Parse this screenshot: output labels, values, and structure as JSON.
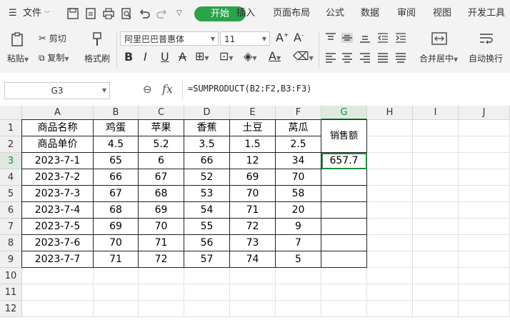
{
  "menubar": {
    "file_label": "文件",
    "tabs": [
      "开始",
      "插入",
      "页面布局",
      "公式",
      "数据",
      "审阅",
      "视图",
      "开发工具"
    ]
  },
  "ribbon": {
    "paste_label": "粘贴",
    "cut_label": "剪切",
    "copy_label": "复制",
    "format_painter_label": "格式刷",
    "font_name": "阿里巴巴普惠体",
    "font_size": "11",
    "merge_label": "合并居中",
    "wrap_label": "自动换行"
  },
  "formula_bar": {
    "name_box": "G3",
    "fx_label": "fx",
    "formula": "=SUMPRODUCT(B2:F2,B3:F3)"
  },
  "sheet": {
    "columns": [
      "A",
      "B",
      "C",
      "D",
      "E",
      "F",
      "G",
      "H",
      "I",
      "J"
    ],
    "rows": [
      "1",
      "2",
      "3",
      "4",
      "5",
      "6",
      "7",
      "8",
      "9",
      "10",
      "11",
      "12"
    ],
    "header": [
      "商品名称",
      "鸡蛋",
      "苹果",
      "香蕉",
      "土豆",
      "莴瓜"
    ],
    "price_row": [
      "商品单价",
      "4.5",
      "5.2",
      "3.5",
      "1.5",
      "2.5"
    ],
    "sales_header": "销售额",
    "data_rows": [
      [
        "2023-7-1",
        "65",
        "6",
        "66",
        "12",
        "34"
      ],
      [
        "2023-7-2",
        "66",
        "67",
        "52",
        "69",
        "70"
      ],
      [
        "2023-7-3",
        "67",
        "68",
        "53",
        "70",
        "58"
      ],
      [
        "2023-7-4",
        "68",
        "69",
        "54",
        "71",
        "20"
      ],
      [
        "2023-7-5",
        "69",
        "70",
        "55",
        "72",
        "9"
      ],
      [
        "2023-7-6",
        "70",
        "71",
        "56",
        "73",
        "7"
      ],
      [
        "2023-7-7",
        "71",
        "72",
        "57",
        "74",
        "5"
      ]
    ],
    "sales_values": [
      "657.7",
      "",
      "",
      "",
      "",
      "",
      ""
    ]
  },
  "colors": {
    "accent": "#2aa34a",
    "selection": "#1f8a3b",
    "selected_header_bg": "#dfe9df"
  }
}
